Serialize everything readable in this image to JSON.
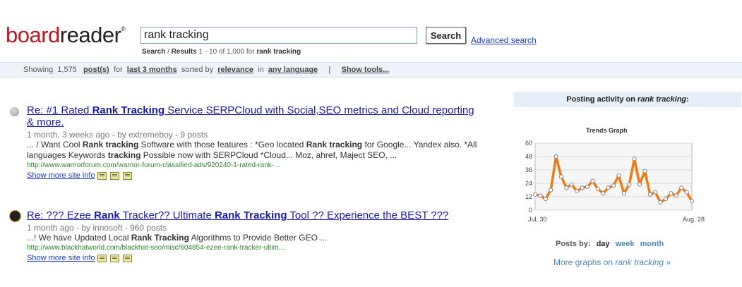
{
  "logo": {
    "part1": "board",
    "part2": "reader",
    "mark": "®"
  },
  "search": {
    "value": "rank tracking",
    "button": "Search",
    "advanced": "Advanced search"
  },
  "crumbs": {
    "search": "Search",
    "sep": "/",
    "results": "Results",
    "range": "1 - 10 of 1,000 for",
    "query": "rank tracking"
  },
  "summary": {
    "showing": "Showing",
    "count": "1,575",
    "posts": "post(s)",
    "for": "for",
    "period": "last 3 months",
    "sorted": "sorted by",
    "relevance": "relevance",
    "in": "in",
    "language": "any language",
    "pipe": "|",
    "show_tools": "Show tools..."
  },
  "results": [
    {
      "title_parts": [
        "Re: #1 Rated ",
        "Rank Tracking",
        " Service SERPCloud with Social,SEO metrics and Cloud reporting & more."
      ],
      "meta": "1 month, 3 weeks ago - by extremeboy - 9 posts",
      "snippet_parts": [
        "... / Want Cool ",
        "Rank tracking",
        " Software with those features : *Geo located ",
        "Rank tracking",
        " for Google... Yandex also. *All languages Keywords ",
        "tracking",
        " Possible now with SERPCloud *Cloud... Moz, ahref, Maject SEO, ..."
      ],
      "url": "http://www.warriorforum.com/warrior-forum-classified-ads/920240-1-rated-rank-...",
      "more": "Show more site info"
    },
    {
      "title_parts": [
        "Re: ??? Ezee ",
        "Rank",
        " Tracker?? Ultimate ",
        "Rank Tracking",
        " Tool ?? Experience the BEST ???"
      ],
      "meta": "1 month ago - by innosoft - 960 posts",
      "snippet_parts": [
        "...! We have Updated Local ",
        "Rank Tracking",
        " Algorithms to Provide Better GEO ..."
      ],
      "url": "http://www.blackhatworld.com/blackhat-seo/misc/604854-ezee-rank-tracker-ultim...",
      "more": "Show more site info"
    }
  ],
  "panel": {
    "head": "Posting activity on",
    "query": "rank tracking",
    "colon": ":",
    "trends_title": "Trends Graph"
  },
  "chart_data": {
    "type": "line",
    "title": "Trends Graph",
    "xlabel": "",
    "ylabel": "",
    "ylim": [
      0,
      60
    ],
    "yticks": [
      0,
      12,
      24,
      36,
      48,
      60
    ],
    "x_tick_labels": [
      "Jul, 30",
      "Aug, 28"
    ],
    "series": [
      {
        "values": [
          14,
          13,
          10,
          18,
          48,
          30,
          20,
          23,
          17,
          20,
          21,
          26,
          19,
          15,
          20,
          22,
          31,
          15,
          23,
          46,
          23,
          35,
          14,
          16,
          7,
          10,
          15,
          13,
          20,
          16,
          8
        ]
      }
    ],
    "colors": {
      "line": "#f07a12",
      "marker_fill": "#ffffff",
      "marker_stroke": "#888888",
      "grid": "#d8d8d8"
    }
  },
  "posts_by": {
    "label": "Posts by:",
    "day": "day",
    "week": "week",
    "month": "month"
  },
  "more_graphs": {
    "prefix": "More graphs on",
    "query": "rank tracking",
    "suffix": "»"
  },
  "colors": {
    "logo_red": "#c0141e",
    "link_blue": "#1a1aa6",
    "url_green": "#2b8a2b",
    "bar_bg": "#eef3f9"
  }
}
